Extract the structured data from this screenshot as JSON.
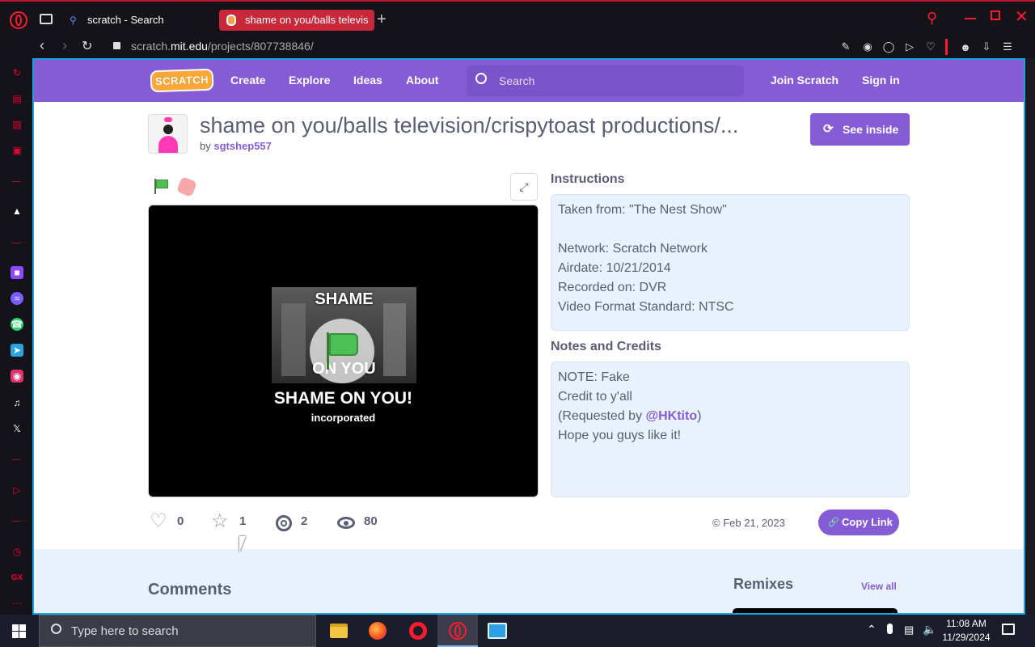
{
  "browser": {
    "tabs": [
      {
        "title": "scratch - Search"
      },
      {
        "title": "shame on you/balls televis"
      }
    ],
    "address": {
      "prefix": "scratch.",
      "domain": "mit.edu",
      "path": "/projects/807738846/"
    }
  },
  "scratch_nav": {
    "logo": "SCRATCH",
    "links": [
      "Create",
      "Explore",
      "Ideas",
      "About"
    ],
    "search_placeholder": "Search",
    "join": "Join Scratch",
    "signin": "Sign in"
  },
  "project": {
    "title": "shame on you/balls television/crispytoast productions/...",
    "by_prefix": "by",
    "author": "sgtshep557",
    "see_inside": "See inside",
    "stage": {
      "line1": "SHAME",
      "line2": "ON YOU",
      "caption": "SHAME ON YOU!",
      "sub": "incorporated"
    },
    "instructions_heading": "Instructions",
    "instructions": [
      "Taken from: \"The Nest Show\"",
      "",
      "Network: Scratch Network",
      "Airdate: 10/21/2014",
      "Recorded on: DVR",
      "Video Format Standard: NTSC"
    ],
    "notes_heading": "Notes and Credits",
    "notes": {
      "line1": "NOTE: Fake",
      "line2": "Credit to y'all",
      "line3_prefix": "(Requested by ",
      "line3_link": "@HKtito",
      "line3_suffix": ")",
      "line4": "Hope you guys like it!"
    },
    "stats": {
      "loves": "0",
      "favorites": "1",
      "remixes": "2",
      "views": "80"
    },
    "date": "Feb 21, 2023",
    "copy_link": "Copy Link"
  },
  "lower": {
    "comments": "Comments",
    "remixes": "Remixes",
    "view_all": "View all"
  },
  "taskbar": {
    "search_placeholder": "Type here to search",
    "time": "11:08 AM",
    "date": "11/29/2024"
  },
  "colors": {
    "scratch_purple": "#855cd6",
    "opera_red": "#ff1b2d",
    "selection_blue": "#1ba3e0"
  }
}
